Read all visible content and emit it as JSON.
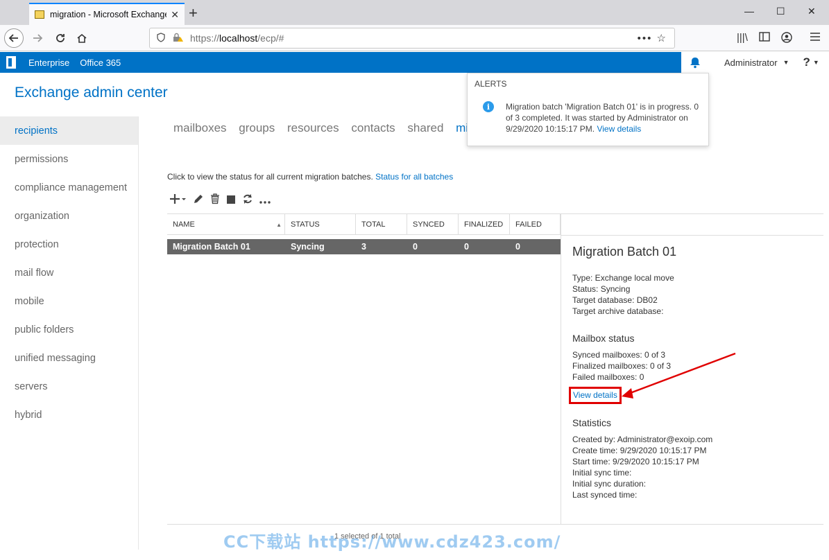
{
  "browser": {
    "tab_title": "migration - Microsoft Exchange",
    "tab_close": "✕",
    "new_tab": "+",
    "url_protocol": "https://",
    "url_host": "localhost",
    "url_path": "/ecp/#",
    "url_more": "•••",
    "window_min": "—",
    "window_max": "☐",
    "window_close": "✕"
  },
  "officebar": {
    "enterprise": "Enterprise",
    "office365": "Office 365",
    "user": "Administrator",
    "help": "?"
  },
  "app_title": "Exchange admin center",
  "nav": {
    "items": [
      "recipients",
      "permissions",
      "compliance management",
      "organization",
      "protection",
      "mail flow",
      "mobile",
      "public folders",
      "unified messaging",
      "servers",
      "hybrid"
    ],
    "active": "recipients"
  },
  "subtabs": [
    "mailboxes",
    "groups",
    "resources",
    "contacts",
    "shared",
    "mig"
  ],
  "hint": {
    "text": "Click to view the status for all current migration batches.",
    "link": "Status for all batches"
  },
  "table": {
    "headers": [
      "NAME",
      "STATUS",
      "TOTAL",
      "SYNCED",
      "FINALIZED",
      "FAILED"
    ],
    "sort_glyph": "▲",
    "row": [
      "Migration Batch 01",
      "Syncing",
      "3",
      "0",
      "0",
      "0"
    ]
  },
  "details": {
    "title": "Migration Batch 01",
    "type": "Type: Exchange local move",
    "status": "Status: Syncing",
    "target_db": "Target database: DB02",
    "target_archive": "Target archive database:",
    "mailbox_status_heading": "Mailbox status",
    "synced": "Synced mailboxes: 0 of 3",
    "finalized": "Finalized mailboxes: 0 of 3",
    "failed": "Failed mailboxes: 0",
    "view_details": "View details",
    "statistics_heading": "Statistics",
    "created_by": "Created by: Administrator@exoip.com",
    "create_time": "Create time: 9/29/2020 10:15:17 PM",
    "start_time": "Start time: 9/29/2020 10:15:17 PM",
    "initial_sync_time": "Initial sync time:",
    "initial_sync_duration": "Initial sync duration:",
    "last_synced": "Last synced time:"
  },
  "alerts": {
    "heading": "ALERTS",
    "message": "Migration batch 'Migration Batch 01' is in progress. 0 of 3 completed. It was started by Administrator on 9/29/2020 10:15:17 PM.",
    "link": "View details"
  },
  "footer": "1 selected of 1 total",
  "watermark": "CC下载站 https://www.cdz423.com/",
  "colors": {
    "accent": "#0072c6",
    "highlight_box": "#e00000",
    "row_selected": "#666666"
  }
}
